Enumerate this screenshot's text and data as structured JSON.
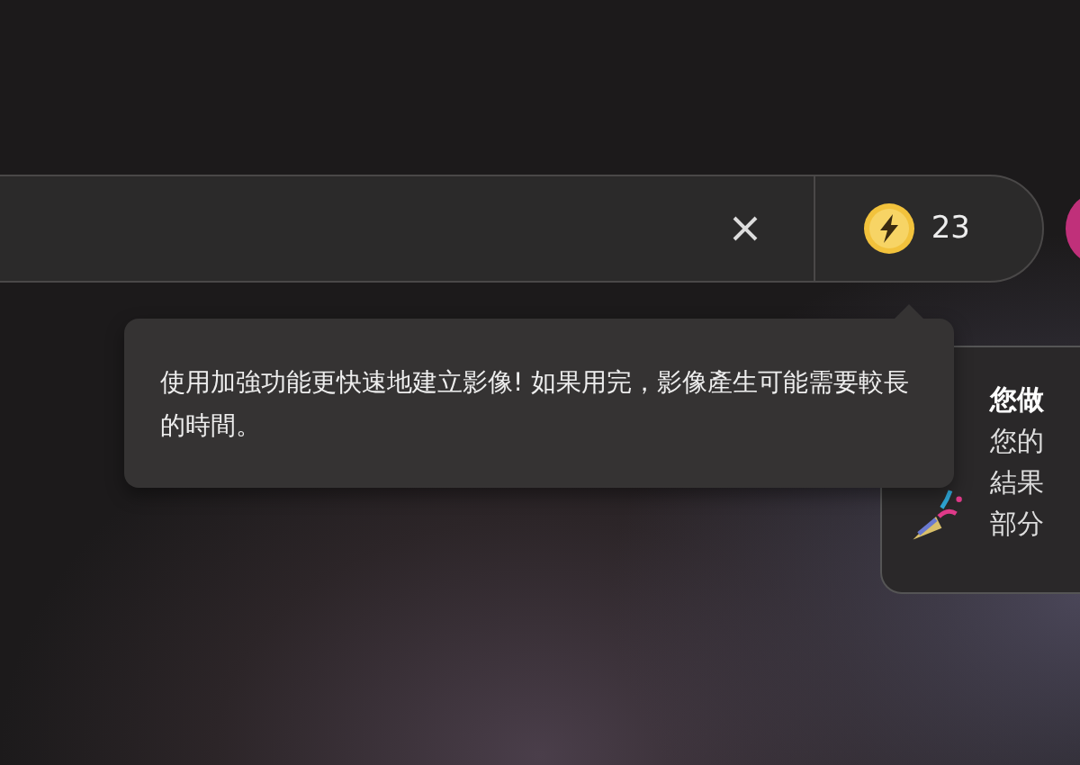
{
  "search_bar": {
    "credits": "23"
  },
  "tooltip": {
    "text": "使用加強功能更快速地建立影像! 如果用完，影像產生可能需要較長的時間。"
  },
  "notification_card": {
    "title": "您做",
    "lines": [
      "您的",
      "結果",
      "部分"
    ]
  }
}
